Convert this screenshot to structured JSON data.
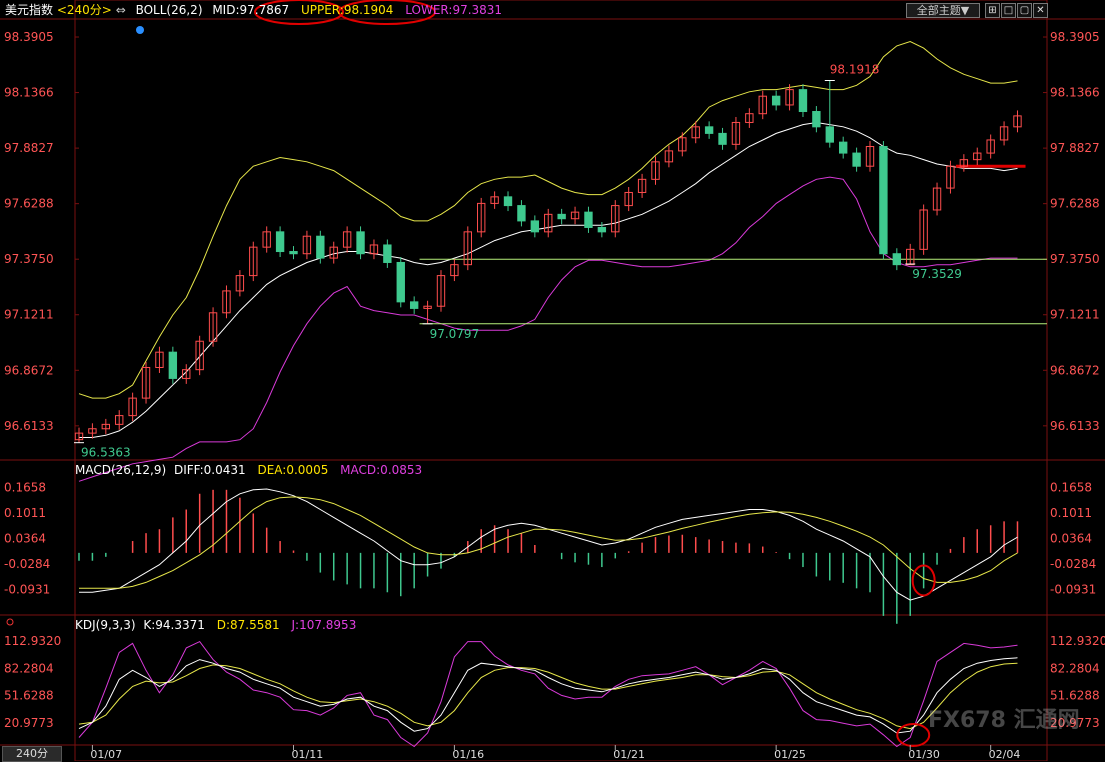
{
  "main_header": {
    "symbol": "美元指数",
    "period": "<240分>",
    "period_arrow": "⇔",
    "indicator": "BOLL(26,2)",
    "mid": "MID:97.7867",
    "upper": "UPPER:98.1904",
    "lower": "LOWER:97.3831"
  },
  "toolbar": {
    "theme_button": "全部主题▼",
    "window_buttons": [
      "⊞",
      "□",
      "▢",
      "✕"
    ]
  },
  "macd_header": {
    "name": "MACD(26,12,9)",
    "diff": "DIFF:0.0431",
    "dea": "DEA:0.0005",
    "macd": "MACD:0.0853"
  },
  "kdj_header": {
    "name": "KDJ(9,3,3)",
    "k": "K:94.3371",
    "d": "D:87.5581",
    "j": "J:107.8953"
  },
  "timeframe_button": "240分",
  "watermark": "FX678 汇通网",
  "colors": {
    "up": "#ff4d4d",
    "down": "#3fc98f",
    "mid": "#ffffff",
    "upper": "#e6e64a",
    "lower": "#d93ad9",
    "grid": "#7a1010",
    "level_line": "#b6f07a",
    "marker_red": "#e00000",
    "axis_label": "#ff5555"
  },
  "chart_data": [
    {
      "type": "candlestick",
      "title": "美元指数 240分",
      "x_tick_labels": [
        "01/07",
        "01/11",
        "01/16",
        "01/21",
        "01/25",
        "01/30",
        "02/04"
      ],
      "y_tick_labels": [
        "98.3905",
        "98.1366",
        "97.8827",
        "97.6288",
        "97.3750",
        "97.1211",
        "96.8672",
        "96.6133"
      ],
      "ylim": [
        96.48,
        98.45
      ],
      "annotations": [
        {
          "label": "98.1918",
          "bar": 56,
          "price": 98.1918,
          "kind": "high"
        },
        {
          "label": "96.5363",
          "bar": 0,
          "price": 96.5363,
          "kind": "low"
        },
        {
          "label": "97.0797",
          "bar": 26,
          "price": 97.0797,
          "kind": "low"
        },
        {
          "label": "97.3529",
          "bar": 62,
          "price": 97.3529,
          "kind": "low"
        }
      ],
      "horizontal_lines": [
        {
          "price": 97.375,
          "from_bar": 26
        },
        {
          "price": 97.0797,
          "from_bar": 26
        },
        {
          "price": 97.8,
          "from_bar": 66,
          "to_bar": 70,
          "style": "thick-red"
        }
      ],
      "closes": [
        96.58,
        96.6,
        96.62,
        96.66,
        96.74,
        96.88,
        96.95,
        96.83,
        96.87,
        97.0,
        97.13,
        97.23,
        97.3,
        97.43,
        97.5,
        97.41,
        97.4,
        97.48,
        97.38,
        97.43,
        97.5,
        97.4,
        97.44,
        97.36,
        97.18,
        97.15,
        97.16,
        97.3,
        97.35,
        97.5,
        97.63,
        97.66,
        97.62,
        97.55,
        97.5,
        97.58,
        97.56,
        97.59,
        97.52,
        97.5,
        97.62,
        97.68,
        97.74,
        97.82,
        97.87,
        97.93,
        97.98,
        97.95,
        97.9,
        98.0,
        98.04,
        98.12,
        98.08,
        98.15,
        98.05,
        97.98,
        97.91,
        97.86,
        97.8,
        97.89,
        97.4,
        97.35,
        97.42,
        97.6,
        97.7,
        97.8,
        97.83,
        97.86,
        97.92,
        97.98,
        98.03
      ],
      "upper": [
        96.76,
        96.74,
        96.74,
        96.76,
        96.8,
        96.91,
        97.02,
        97.12,
        97.2,
        97.33,
        97.48,
        97.62,
        97.74,
        97.8,
        97.82,
        97.84,
        97.83,
        97.82,
        97.8,
        97.78,
        97.74,
        97.7,
        97.66,
        97.62,
        97.57,
        97.55,
        97.55,
        97.58,
        97.62,
        97.68,
        97.72,
        97.74,
        97.75,
        97.75,
        97.76,
        97.73,
        97.7,
        97.68,
        97.67,
        97.67,
        97.7,
        97.74,
        97.79,
        97.85,
        97.9,
        97.94,
        98.0,
        98.07,
        98.1,
        98.12,
        98.14,
        98.15,
        98.15,
        98.16,
        98.17,
        98.16,
        98.15,
        98.15,
        98.17,
        98.21,
        98.3,
        98.35,
        98.37,
        98.34,
        98.29,
        98.25,
        98.22,
        98.2,
        98.18,
        98.18,
        98.19
      ],
      "mid": [
        96.56,
        96.56,
        96.57,
        96.59,
        96.63,
        96.68,
        96.74,
        96.8,
        96.86,
        96.93,
        97.0,
        97.07,
        97.14,
        97.2,
        97.26,
        97.3,
        97.33,
        97.36,
        97.38,
        97.4,
        97.41,
        97.41,
        97.4,
        97.39,
        97.38,
        97.36,
        97.35,
        97.36,
        97.38,
        97.4,
        97.43,
        97.46,
        97.48,
        97.5,
        97.51,
        97.52,
        97.53,
        97.53,
        97.53,
        97.53,
        97.54,
        97.56,
        97.58,
        97.61,
        97.64,
        97.68,
        97.72,
        97.77,
        97.81,
        97.85,
        97.89,
        97.92,
        97.95,
        97.97,
        97.99,
        98.0,
        97.99,
        97.98,
        97.96,
        97.93,
        97.89,
        97.86,
        97.85,
        97.83,
        97.81,
        97.8,
        97.79,
        97.79,
        97.79,
        97.78,
        97.79
      ],
      "lower": [
        96.36,
        96.38,
        96.4,
        96.42,
        96.44,
        96.45,
        96.46,
        96.47,
        96.51,
        96.54,
        96.54,
        96.54,
        96.55,
        96.6,
        96.72,
        96.86,
        96.98,
        97.08,
        97.16,
        97.22,
        97.25,
        97.16,
        97.14,
        97.13,
        97.12,
        97.12,
        97.1,
        97.08,
        97.06,
        97.05,
        97.05,
        97.05,
        97.05,
        97.07,
        97.1,
        97.2,
        97.28,
        97.34,
        97.37,
        97.37,
        97.36,
        97.35,
        97.34,
        97.34,
        97.34,
        97.35,
        97.36,
        97.37,
        97.4,
        97.45,
        97.52,
        97.57,
        97.63,
        97.67,
        97.71,
        97.74,
        97.75,
        97.74,
        97.65,
        97.5,
        97.4,
        97.36,
        97.34,
        97.34,
        97.35,
        97.35,
        97.36,
        97.37,
        97.38,
        97.38,
        97.38
      ]
    },
    {
      "type": "macd",
      "y_tick_labels": [
        "0.1658",
        "0.1011",
        "0.0364",
        "-0.0284",
        "-0.0931"
      ],
      "ylim": [
        -0.145,
        0.19
      ],
      "diff": [
        -0.1,
        -0.1,
        -0.095,
        -0.09,
        -0.07,
        -0.05,
        -0.03,
        0.0,
        0.03,
        0.07,
        0.1,
        0.13,
        0.15,
        0.16,
        0.162,
        0.155,
        0.145,
        0.13,
        0.11,
        0.09,
        0.07,
        0.05,
        0.03,
        0.005,
        -0.02,
        -0.03,
        -0.03,
        -0.025,
        -0.01,
        0.015,
        0.04,
        0.06,
        0.07,
        0.075,
        0.07,
        0.06,
        0.05,
        0.04,
        0.03,
        0.02,
        0.025,
        0.035,
        0.05,
        0.065,
        0.075,
        0.085,
        0.09,
        0.095,
        0.1,
        0.105,
        0.11,
        0.11,
        0.105,
        0.095,
        0.08,
        0.06,
        0.045,
        0.03,
        0.01,
        -0.01,
        -0.06,
        -0.1,
        -0.12,
        -0.11,
        -0.09,
        -0.07,
        -0.05,
        -0.03,
        -0.01,
        0.02,
        0.04
      ],
      "dea": [
        -0.09,
        -0.09,
        -0.09,
        -0.09,
        -0.085,
        -0.075,
        -0.06,
        -0.045,
        -0.025,
        -0.005,
        0.02,
        0.05,
        0.08,
        0.11,
        0.13,
        0.14,
        0.142,
        0.14,
        0.135,
        0.125,
        0.11,
        0.095,
        0.075,
        0.055,
        0.035,
        0.015,
        0.0,
        -0.005,
        -0.005,
        0.0,
        0.01,
        0.025,
        0.04,
        0.05,
        0.06,
        0.06,
        0.058,
        0.052,
        0.045,
        0.038,
        0.032,
        0.033,
        0.037,
        0.045,
        0.053,
        0.062,
        0.07,
        0.078,
        0.085,
        0.092,
        0.098,
        0.102,
        0.104,
        0.103,
        0.098,
        0.09,
        0.08,
        0.068,
        0.055,
        0.04,
        0.02,
        -0.01,
        -0.04,
        -0.065,
        -0.075,
        -0.075,
        -0.07,
        -0.06,
        -0.045,
        -0.02,
        0.0
      ]
    },
    {
      "type": "kdj",
      "y_tick_labels": [
        "112.9320",
        "82.2804",
        "51.6288",
        "20.9773"
      ],
      "ylim": [
        0,
        125
      ],
      "k": [
        15,
        22,
        40,
        70,
        80,
        72,
        62,
        70,
        85,
        92,
        88,
        82,
        78,
        70,
        65,
        60,
        50,
        45,
        40,
        42,
        48,
        50,
        40,
        35,
        22,
        12,
        15,
        30,
        55,
        80,
        88,
        86,
        84,
        82,
        80,
        72,
        65,
        60,
        58,
        56,
        60,
        65,
        68,
        70,
        72,
        75,
        78,
        75,
        70,
        72,
        76,
        82,
        80,
        70,
        55,
        45,
        40,
        35,
        30,
        28,
        20,
        10,
        12,
        30,
        55,
        70,
        82,
        88,
        91,
        93,
        94
      ],
      "d": [
        20,
        22,
        30,
        48,
        62,
        68,
        66,
        67,
        74,
        82,
        86,
        85,
        82,
        76,
        70,
        65,
        57,
        50,
        45,
        44,
        46,
        48,
        45,
        40,
        32,
        22,
        18,
        22,
        35,
        55,
        72,
        80,
        83,
        83,
        82,
        78,
        72,
        66,
        62,
        59,
        59,
        62,
        65,
        68,
        70,
        72,
        75,
        75,
        73,
        72,
        74,
        78,
        79,
        75,
        65,
        55,
        48,
        42,
        36,
        32,
        26,
        18,
        15,
        22,
        38,
        55,
        68,
        78,
        84,
        87,
        88
      ],
      "j": [
        5,
        22,
        60,
        100,
        110,
        80,
        55,
        75,
        105,
        112,
        92,
        78,
        70,
        58,
        55,
        50,
        36,
        35,
        30,
        38,
        52,
        55,
        30,
        25,
        5,
        -5,
        10,
        45,
        95,
        112,
        112,
        96,
        86,
        80,
        76,
        60,
        52,
        48,
        50,
        50,
        62,
        70,
        74,
        75,
        76,
        80,
        84,
        75,
        64,
        72,
        80,
        90,
        82,
        60,
        35,
        25,
        24,
        21,
        18,
        20,
        8,
        -5,
        5,
        46,
        90,
        100,
        110,
        108,
        105,
        106,
        108
      ]
    }
  ]
}
